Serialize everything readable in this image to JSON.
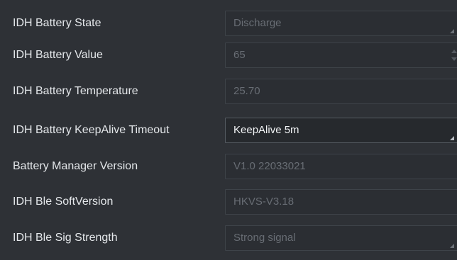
{
  "rows": [
    {
      "label": "IDH Battery State",
      "value": "Discharge"
    },
    {
      "label": "IDH Battery Value",
      "value": "65"
    },
    {
      "label": "IDH Battery Temperature",
      "value": "25.70"
    },
    {
      "label": "IDH Battery KeepAlive Timeout",
      "value": "KeepAlive 5m"
    },
    {
      "label": "Battery Manager Version",
      "value": "V1.0 22033021"
    },
    {
      "label": "IDH Ble SoftVersion",
      "value": "HKVS-V3.18"
    },
    {
      "label": "IDH Ble Sig Strength",
      "value": "Strong signal"
    }
  ],
  "icons": {
    "dropdown": "combo-arrow-icon",
    "spin_up": "spin-up-arrow-icon",
    "spin_down": "spin-down-arrow-icon"
  },
  "colors": {
    "background": "#2e3136",
    "label_text": "#e4e7ea",
    "disabled_text": "#686d74",
    "active_text": "#f2f4f6"
  }
}
